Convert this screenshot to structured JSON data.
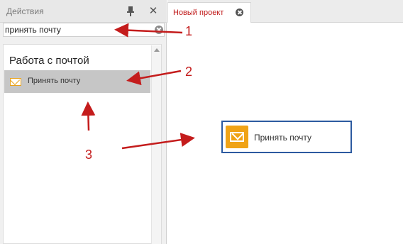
{
  "actions_panel": {
    "title": "Действия",
    "close_glyph": "✕",
    "search": {
      "value": "принять почту"
    },
    "group_title": "Работа с почтой",
    "item": {
      "label": "Принять почту",
      "icon": "mail-icon"
    }
  },
  "tabs": [
    {
      "label": "Новый проект"
    }
  ],
  "canvas": {
    "block": {
      "label": "Принять почту",
      "icon": "mail-icon"
    }
  },
  "annotations": {
    "marker_1": "1",
    "marker_2": "2",
    "marker_3": "3"
  },
  "colors": {
    "accent": "#c01818",
    "annotation": "#c41c1c",
    "block_border": "#2c5aa0",
    "mail_icon": "#f0a316",
    "selection": "#c6c6c6"
  }
}
